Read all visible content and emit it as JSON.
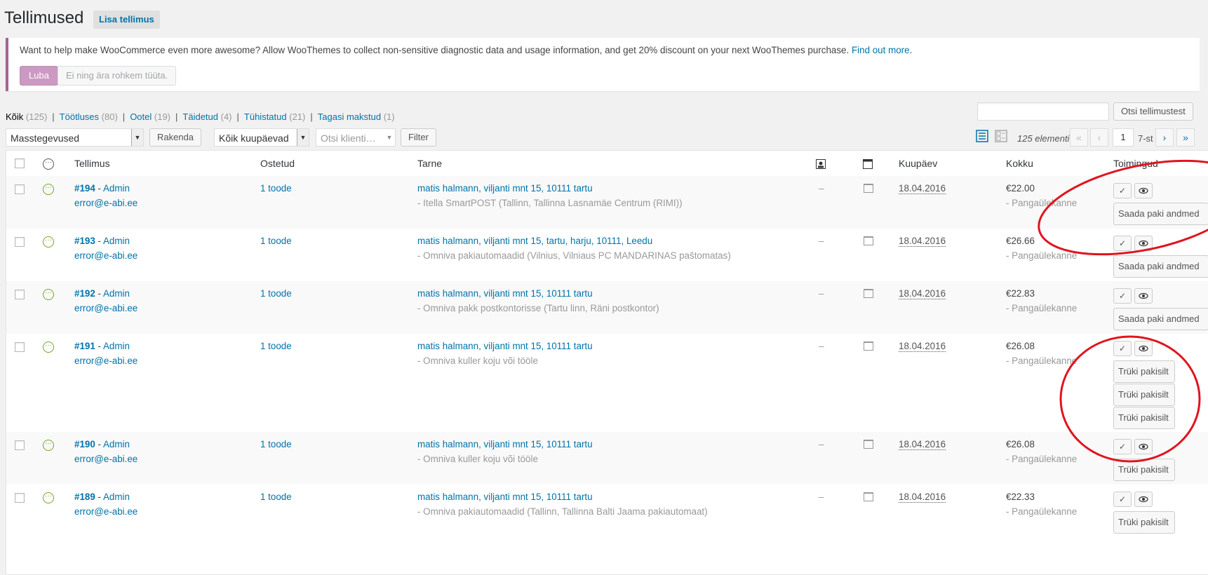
{
  "header": {
    "title": "Tellimused",
    "add_label": "Lisa tellimus"
  },
  "notice": {
    "text": "Want to help make WooCommerce even more awesome? Allow WooThemes to collect non-sensitive diagnostic data and usage information, and get 20% discount on your next WooThemes purchase.",
    "link": "Find out more",
    "allow_label": "Luba",
    "deny_label": "Ei ning ära rohkem tüüta."
  },
  "filters": [
    {
      "label": "Kõik",
      "count": "(125)"
    },
    {
      "label": "Töötluses",
      "count": "(80)"
    },
    {
      "label": "Ootel",
      "count": "(19)"
    },
    {
      "label": "Täidetud",
      "count": "(4)"
    },
    {
      "label": "Tühistatud",
      "count": "(21)"
    },
    {
      "label": "Tagasi makstud",
      "count": "(1)"
    }
  ],
  "search": {
    "button": "Otsi tellimustest",
    "value": ""
  },
  "toolbar": {
    "bulk": "Masstegevused",
    "apply": "Rakenda",
    "dates": "Kõik kuupäevad",
    "customer_placeholder": "Otsi klienti…",
    "filter": "Filter",
    "items": "125 elementi",
    "page": "1",
    "total": "7-st"
  },
  "pagination": {
    "first": "«",
    "prev": "‹",
    "next": "›",
    "last": "»"
  },
  "columns": {
    "order": "Tellimus",
    "purchased": "Ostetud",
    "shipping": "Tarne",
    "date": "Kuupäev",
    "total": "Kokku",
    "actions": "Toimingud"
  },
  "orders": [
    {
      "order": "#194",
      "by": "Admin",
      "email": "error@e-abi.ee",
      "items": "1 toode",
      "address": "matis halmann, viljanti mnt 15, 10111 tartu",
      "method": "- Itella SmartPOST (Tallinn, Tallinna Lasnamäe Centrum (RIMI))",
      "note": "–",
      "date": "18.04.2016",
      "total": "€22.00",
      "payment": "- Pangaülekanne",
      "buttons": [
        "Saada paki andmed"
      ]
    },
    {
      "order": "#193",
      "by": "Admin",
      "email": "error@e-abi.ee",
      "items": "1 toode",
      "address": "matis halmann, viljanti mnt 15, tartu, harju, 10111, Leedu",
      "method": "- Omniva pakiautomaadid (Vilnius, Vilniaus PC MANDARINAS paštomatas)",
      "note": "–",
      "date": "18.04.2016",
      "total": "€26.66",
      "payment": "- Pangaülekanne",
      "buttons": [
        "Saada paki andmed"
      ]
    },
    {
      "order": "#192",
      "by": "Admin",
      "email": "error@e-abi.ee",
      "items": "1 toode",
      "address": "matis halmann, viljanti mnt 15, 10111 tartu",
      "method": "- Omniva pakk postkontorisse (Tartu linn, Räni postkontor)",
      "note": "–",
      "date": "18.04.2016",
      "total": "€22.83",
      "payment": "- Pangaülekanne",
      "buttons": [
        "Saada paki andmed"
      ]
    },
    {
      "order": "#191",
      "by": "Admin",
      "email": "error@e-abi.ee",
      "items": "1 toode",
      "address": "matis halmann, viljanti mnt 15, 10111 tartu",
      "method": "- Omniva kuller koju või tööle",
      "note": "–",
      "date": "18.04.2016",
      "total": "€26.08",
      "payment": "- Pangaülekanne",
      "buttons": [
        "Trüki pakisilt",
        "Trüki pakisilt",
        "Trüki pakisilt"
      ]
    },
    {
      "order": "#190",
      "by": "Admin",
      "email": "error@e-abi.ee",
      "items": "1 toode",
      "address": "matis halmann, viljanti mnt 15, 10111 tartu",
      "method": "- Omniva kuller koju või tööle",
      "note": "–",
      "date": "18.04.2016",
      "total": "€26.08",
      "payment": "- Pangaülekanne",
      "buttons": [
        "Trüki pakisilt"
      ]
    },
    {
      "order": "#189",
      "by": "Admin",
      "email": "error@e-abi.ee",
      "items": "1 toode",
      "address": "matis halmann, viljanti mnt 15, 10111 tartu",
      "method": "- Omniva pakiautomaadid (Tallinn, Tallinna Balti Jaama pakiautomaat)",
      "note": "–",
      "date": "18.04.2016",
      "total": "€22.33",
      "payment": "- Pangaülekanne",
      "buttons": [
        "Trüki pakisilt"
      ]
    }
  ],
  "colors": {
    "accent": "#0073aa",
    "woo": "#a46497",
    "status": "#73a724",
    "annotation": "#e0141e"
  },
  "icons": {
    "complete": "checkmark-icon",
    "view": "eye-icon",
    "status": "status-icon",
    "notes": "notes-icon"
  }
}
